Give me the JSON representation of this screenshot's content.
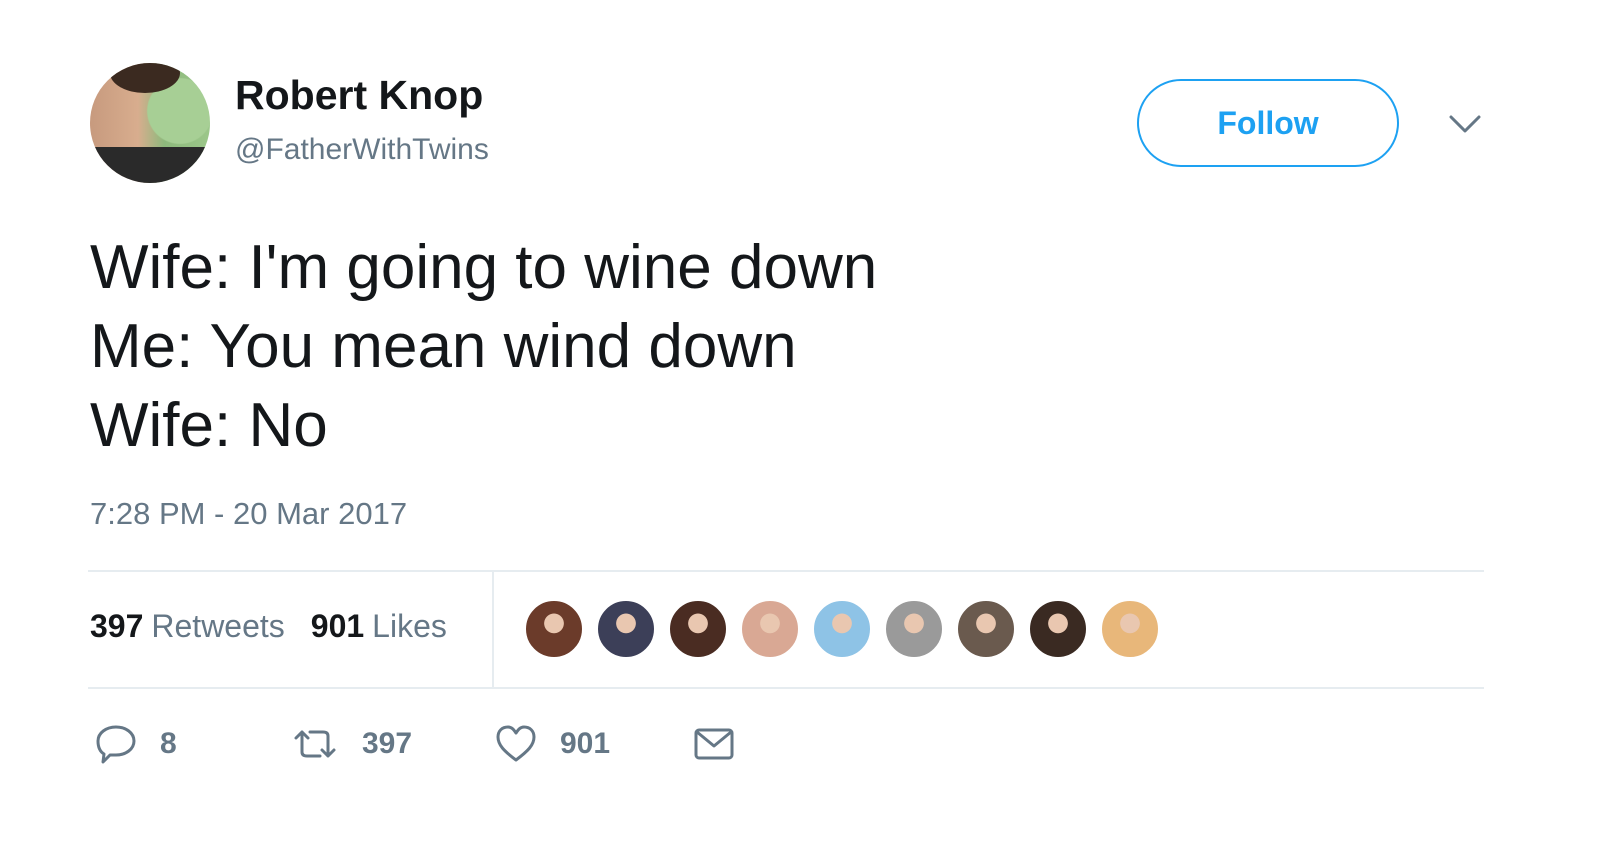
{
  "tweet": {
    "author": {
      "name": "Robert Knop",
      "handle": "@FatherWithTwins"
    },
    "follow_label": "Follow",
    "text_lines": [
      "Wife: I'm going to wine down",
      "Me: You mean wind down",
      "Wife: No"
    ],
    "timestamp": "7:28 PM - 20 Mar 2017",
    "stats": {
      "retweets_count": "397",
      "retweets_label": "Retweets",
      "likes_count": "901",
      "likes_label": "Likes"
    },
    "likers": [
      {
        "icon": "liker-avatar",
        "color": "#6b3b2a"
      },
      {
        "icon": "liker-avatar",
        "color": "#3c3f58"
      },
      {
        "icon": "liker-avatar",
        "color": "#4a2c22"
      },
      {
        "icon": "liker-avatar",
        "color": "#d9a894"
      },
      {
        "icon": "liker-avatar",
        "color": "#8ec3e6"
      },
      {
        "icon": "liker-avatar",
        "color": "#9a9a9a"
      },
      {
        "icon": "liker-avatar",
        "color": "#6a5a4e"
      },
      {
        "icon": "liker-avatar",
        "color": "#3a2a22"
      },
      {
        "icon": "liker-avatar",
        "color": "#e8b77a"
      }
    ],
    "actions": {
      "reply_count": "8",
      "retweet_count": "397",
      "like_count": "901"
    },
    "colors": {
      "accent": "#1da1f2",
      "muted": "#657786",
      "text": "#14171a",
      "divider": "#e6ecf0"
    }
  }
}
